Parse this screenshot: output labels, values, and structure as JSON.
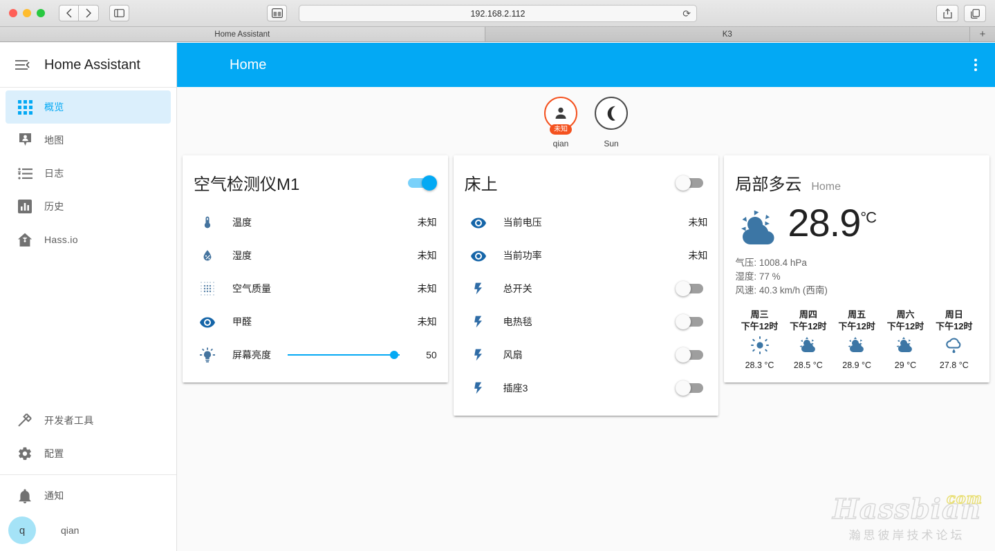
{
  "browser": {
    "url": "192.168.2.112",
    "back_icon": "chevron-left-icon",
    "forward_icon": "chevron-right-icon",
    "sidebar_icon": "sidebar-toggle-icon",
    "tab_overview_icon": "tab-overview-icon",
    "reload_icon": "reload-icon",
    "share_icon": "share-icon",
    "new_tab_icon": "new-tab-icon",
    "tabs": [
      {
        "label": "Home Assistant",
        "active": true
      },
      {
        "label": "K3",
        "active": false
      }
    ],
    "new_tab_label": "+"
  },
  "sidebar": {
    "title": "Home Assistant",
    "menu_icon": "hamburger-menu-icon",
    "items": [
      {
        "label": "概览",
        "icon": "view-dashboard-icon",
        "active": true
      },
      {
        "label": "地图",
        "icon": "account-location-icon",
        "active": false
      },
      {
        "label": "日志",
        "icon": "format-list-bulleted-icon",
        "active": false
      },
      {
        "label": "历史",
        "icon": "chart-box-icon",
        "active": false
      },
      {
        "label": "Hass.io",
        "icon": "hassio-home-icon",
        "active": false
      }
    ],
    "lower_items": [
      {
        "label": "开发者工具",
        "icon": "hammer-icon"
      },
      {
        "label": "配置",
        "icon": "cog-icon"
      }
    ],
    "notifications": {
      "label": "通知",
      "icon": "bell-icon"
    },
    "user": {
      "name": "qian",
      "initial": "q"
    }
  },
  "toolbar": {
    "title": "Home",
    "menu_icon": "dots-vertical-icon"
  },
  "badges": [
    {
      "label": "qian",
      "icon": "account-icon",
      "value": "未知",
      "alerted": true
    },
    {
      "label": "Sun",
      "icon": "moon-waning-crescent-icon",
      "value": "",
      "alerted": false
    }
  ],
  "cards": {
    "air_monitor": {
      "title": "空气检测仪M1",
      "toggle_on": true,
      "rows": [
        {
          "icon": "thermometer-icon",
          "name": "温度",
          "value": "未知",
          "type": "value"
        },
        {
          "icon": "water-percent-icon",
          "name": "湿度",
          "value": "未知",
          "type": "value"
        },
        {
          "icon": "blur-grid-icon",
          "name": "空气质量",
          "value": "未知",
          "type": "value"
        },
        {
          "icon": "eye-icon",
          "name": "甲醛",
          "value": "未知",
          "type": "value"
        },
        {
          "icon": "lightbulb-on-icon",
          "name": "屏幕亮度",
          "value": "50",
          "type": "slider",
          "slider_percent": 95
        }
      ]
    },
    "bed": {
      "title": "床上",
      "toggle_on": false,
      "rows": [
        {
          "icon": "eye-icon",
          "name": "当前电压",
          "value": "未知",
          "type": "value"
        },
        {
          "icon": "eye-icon",
          "name": "当前功率",
          "value": "未知",
          "type": "value"
        },
        {
          "icon": "flash-icon",
          "name": "总开关",
          "type": "toggle",
          "toggle_on": false
        },
        {
          "icon": "flash-icon",
          "name": "电热毯",
          "type": "toggle",
          "toggle_on": false
        },
        {
          "icon": "flash-icon",
          "name": "风扇",
          "type": "toggle",
          "toggle_on": false
        },
        {
          "icon": "flash-icon",
          "name": "插座3",
          "type": "toggle",
          "toggle_on": false
        }
      ]
    },
    "weather": {
      "state": "局部多云",
      "location": "Home",
      "icon": "weather-partly-cloudy-icon",
      "temperature": "28.9",
      "unit": "°C",
      "attributes": [
        "气压: 1008.4 hPa",
        "湿度: 77 %",
        "风速: 40.3 km/h (西南)"
      ],
      "forecast": [
        {
          "day": "周三",
          "time": "下午12时",
          "icon": "weather-sunny-icon",
          "temp": "28.3 °C"
        },
        {
          "day": "周四",
          "time": "下午12时",
          "icon": "weather-partly-cloudy-icon",
          "temp": "28.5 °C"
        },
        {
          "day": "周五",
          "time": "下午12时",
          "icon": "weather-partly-cloudy-icon",
          "temp": "28.9 °C"
        },
        {
          "day": "周六",
          "time": "下午12时",
          "icon": "weather-partly-cloudy-icon",
          "temp": "29 °C"
        },
        {
          "day": "周日",
          "time": "下午12时",
          "icon": "weather-rainy-icon",
          "temp": "27.8 °C"
        }
      ]
    }
  },
  "watermark": {
    "main": "Hassbian",
    "com": "com",
    "sub": "瀚思彼岸技术论坛"
  },
  "colors": {
    "accent": "#03a9f4",
    "entity_icon": "#44739e",
    "alert": "#f4511e",
    "background": "#fafafa"
  }
}
